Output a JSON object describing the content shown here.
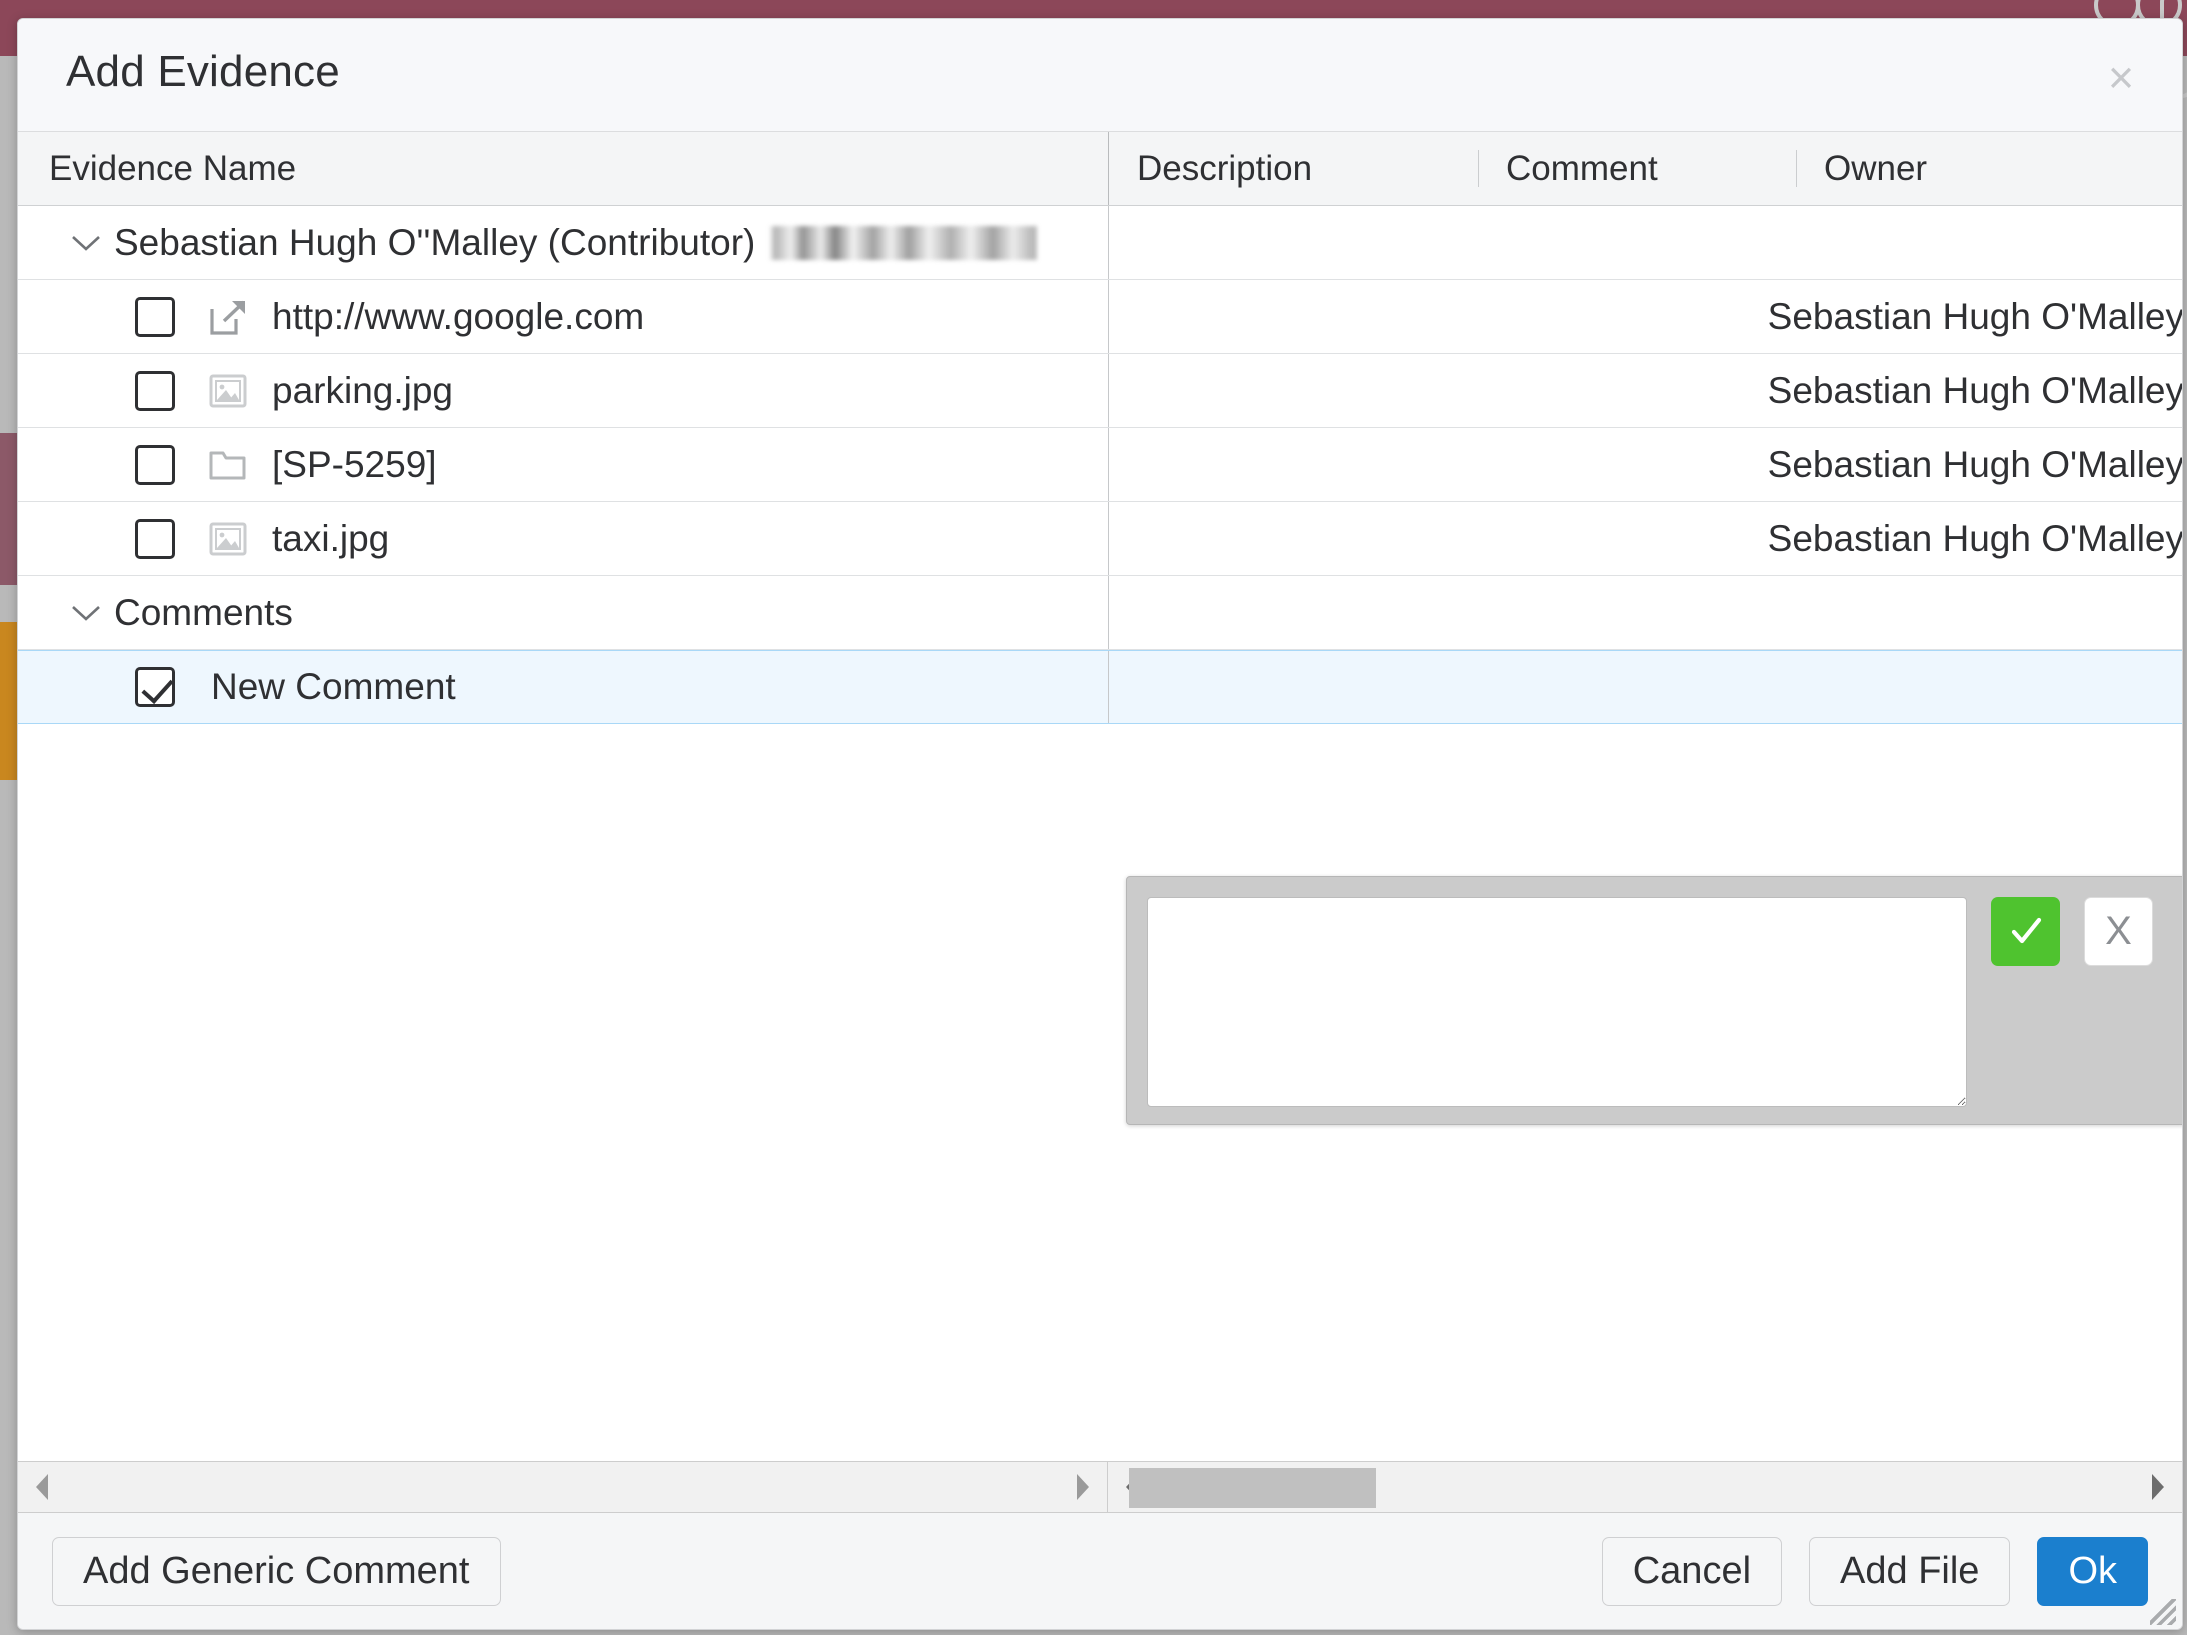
{
  "window": {
    "title": "Add Evidence",
    "close_label": "×"
  },
  "table": {
    "columns": [
      {
        "key": "evidence_name",
        "label": "Evidence Name"
      },
      {
        "key": "description",
        "label": "Description"
      },
      {
        "key": "comment",
        "label": "Comment"
      },
      {
        "key": "owner",
        "label": "Owner"
      }
    ],
    "groups": [
      {
        "label": "Sebastian Hugh O''Malley (Contributor)",
        "redacted_suffix": true,
        "expanded": true,
        "twisty_icon": "chevron-down-icon",
        "rows": [
          {
            "checked": false,
            "icon": "external-link-icon",
            "name": "http://www.google.com",
            "description": "",
            "comment": "",
            "owner": "Sebastian Hugh O'Malley"
          },
          {
            "checked": false,
            "icon": "image-icon",
            "name": "parking.jpg",
            "description": "",
            "comment": "",
            "owner": "Sebastian Hugh O'Malley"
          },
          {
            "checked": false,
            "icon": "folder-icon",
            "name": "[SP-5259]",
            "description": "",
            "comment": "",
            "owner": "Sebastian Hugh O'Malley"
          },
          {
            "checked": false,
            "icon": "image-icon",
            "name": "taxi.jpg",
            "description": "",
            "comment": "",
            "owner": "Sebastian Hugh O'Malley"
          }
        ]
      },
      {
        "label": "Comments",
        "redacted_suffix": false,
        "expanded": true,
        "twisty_icon": "chevron-down-icon",
        "rows": [
          {
            "checked": true,
            "icon": "",
            "name": "New Comment",
            "description": "",
            "comment": "",
            "owner": "",
            "selected": true
          }
        ]
      }
    ]
  },
  "comment_editor": {
    "visible": true,
    "value": "",
    "placeholder": "",
    "confirm_label": "✓",
    "cancel_label": "X"
  },
  "scrollbars": {
    "left": {
      "thumb_left_pct": 0,
      "thumb_width_pct": 0,
      "left_arrow": "◀",
      "right_arrow": "▶"
    },
    "right": {
      "thumb_left_pct": 2,
      "thumb_width_pct": 23,
      "left_arrow": "◀",
      "right_arrow": "▶"
    }
  },
  "footer": {
    "add_generic_comment_label": "Add Generic Comment",
    "cancel_label": "Cancel",
    "add_file_label": "Add File",
    "ok_label": "Ok"
  },
  "colors": {
    "accent_primary": "#1b7fce",
    "confirm_green": "#4fc32f",
    "selected_row": "#eef7fe",
    "selected_border": "#a9d8f7",
    "backdrop_maroon": "#8c4759",
    "backdrop_orange": "#c9871f"
  }
}
